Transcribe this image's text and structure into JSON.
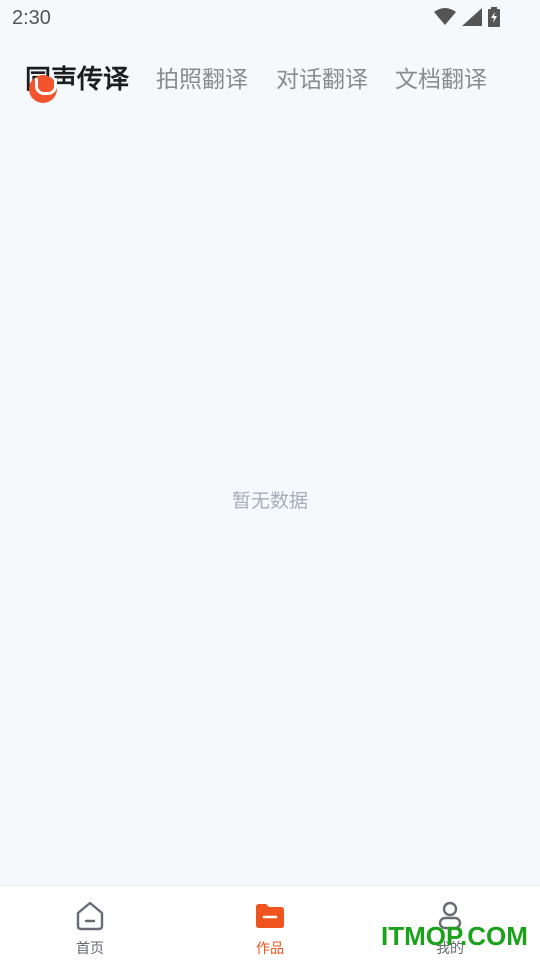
{
  "status_bar": {
    "time": "2:30"
  },
  "tabs": [
    {
      "label": "同声传译",
      "active": true
    },
    {
      "label": "拍照翻译",
      "active": false
    },
    {
      "label": "对话翻译",
      "active": false
    },
    {
      "label": "文档翻译",
      "active": false
    }
  ],
  "content": {
    "empty_message": "暂无数据"
  },
  "bottom_nav": [
    {
      "label": "首页",
      "icon": "home-icon",
      "active": false
    },
    {
      "label": "作品",
      "icon": "folder-icon",
      "active": true
    },
    {
      "label": "我的",
      "icon": "user-icon",
      "active": false
    }
  ],
  "watermark": {
    "text": "ITMOP.COM"
  },
  "colors": {
    "accent": "#f0541e",
    "background": "#f5f9fc",
    "inactive_tab": "#8b8b8b",
    "watermark": "#1aa21a"
  }
}
